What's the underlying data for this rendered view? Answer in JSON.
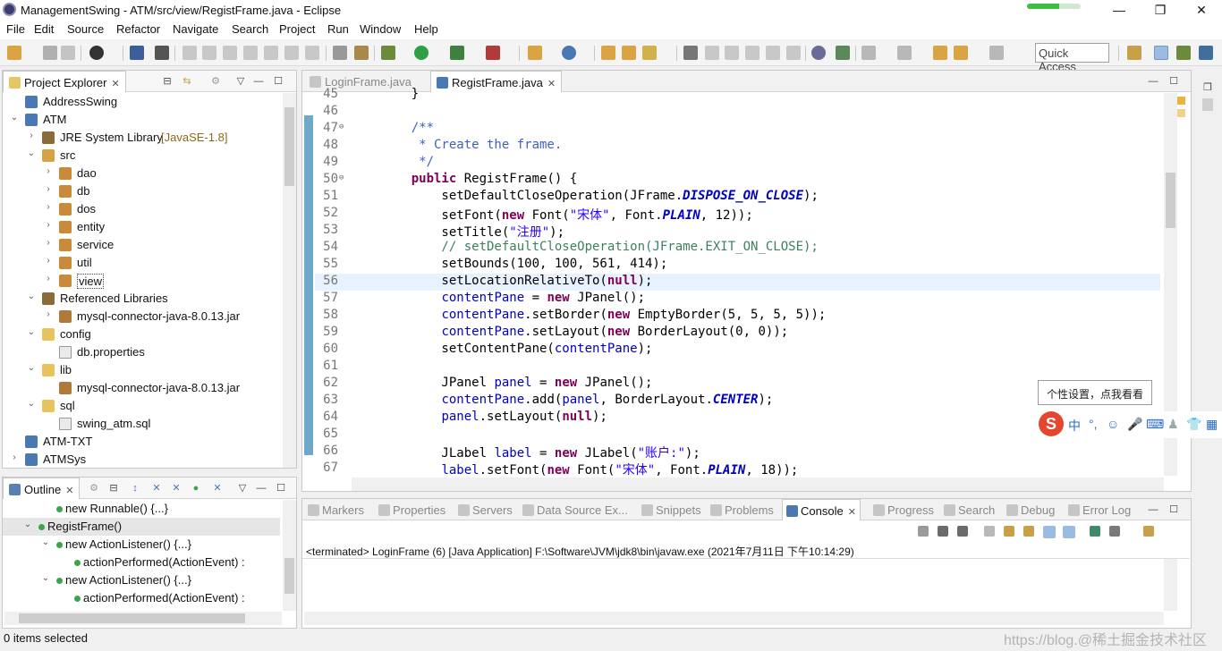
{
  "window": {
    "title": "ManagementSwing - ATM/src/view/RegistFrame.java - Eclipse",
    "controls": {
      "minimize": "—",
      "restore": "❐",
      "close": "✕"
    },
    "progress_fraction": 0.6
  },
  "menu": [
    "File",
    "Edit",
    "Source",
    "Refactor",
    "Navigate",
    "Search",
    "Project",
    "Run",
    "Window",
    "Help"
  ],
  "toolbar": {
    "quick_access": "Quick Access"
  },
  "project_explorer": {
    "tab_label": "Project Explorer",
    "close": "✕",
    "tree": [
      {
        "label": "AddressSwing",
        "icon": "project-icon",
        "arrow": ""
      },
      {
        "label": "ATM",
        "icon": "project-icon",
        "arrow": "⌄"
      },
      {
        "label": "JRE System Library",
        "label2": "[JavaSE-1.8]",
        "icon": "library-icon",
        "arrow": "›"
      },
      {
        "label": "src",
        "icon": "source-folder-icon",
        "arrow": "⌄"
      },
      {
        "label": "dao",
        "icon": "package-icon",
        "arrow": "›"
      },
      {
        "label": "db",
        "icon": "package-icon",
        "arrow": "›"
      },
      {
        "label": "dos",
        "icon": "package-icon",
        "arrow": "›"
      },
      {
        "label": "entity",
        "icon": "package-icon",
        "arrow": "›"
      },
      {
        "label": "service",
        "icon": "package-icon",
        "arrow": "›"
      },
      {
        "label": "util",
        "icon": "package-icon",
        "arrow": "›"
      },
      {
        "label": "view",
        "icon": "package-icon",
        "arrow": "›"
      },
      {
        "label": "Referenced Libraries",
        "icon": "library-icon",
        "arrow": "⌄"
      },
      {
        "label": "mysql-connector-java-8.0.13.jar",
        "icon": "jar-icon",
        "arrow": "›"
      },
      {
        "label": "config",
        "icon": "folder-icon",
        "arrow": "⌄"
      },
      {
        "label": "db.properties",
        "icon": "file-icon",
        "arrow": ""
      },
      {
        "label": "lib",
        "icon": "folder-icon",
        "arrow": "⌄"
      },
      {
        "label": "mysql-connector-java-8.0.13.jar",
        "icon": "jar-icon",
        "arrow": ""
      },
      {
        "label": "sql",
        "icon": "folder-icon",
        "arrow": "⌄"
      },
      {
        "label": "swing_atm.sql",
        "icon": "file-icon",
        "arrow": ""
      },
      {
        "label": "ATM-TXT",
        "icon": "project-icon",
        "arrow": ""
      },
      {
        "label": "ATMSys",
        "icon": "project-icon",
        "arrow": "›"
      }
    ]
  },
  "editor": {
    "tabs": [
      {
        "label": "LoginFrame.java",
        "active": false
      },
      {
        "label": "RegistFrame.java",
        "active": true,
        "close": "✕"
      }
    ],
    "lines": [
      {
        "n": "45",
        "code": "    }"
      },
      {
        "n": "46",
        "code": ""
      },
      {
        "n": "47",
        "code": "    /**",
        "fold": "⊖"
      },
      {
        "n": "48",
        "code": "     * Create the frame."
      },
      {
        "n": "49",
        "code": "     */"
      },
      {
        "n": "50",
        "code": "    public RegistFrame() {",
        "fold": "⊖"
      },
      {
        "n": "51",
        "code": "        setDefaultCloseOperation(JFrame.DISPOSE_ON_CLOSE);"
      },
      {
        "n": "52",
        "code": "        setFont(new Font(\"宋体\", Font.PLAIN, 12));"
      },
      {
        "n": "53",
        "code": "        setTitle(\"注册\");"
      },
      {
        "n": "54",
        "code": "        // setDefaultCloseOperation(JFrame.EXIT_ON_CLOSE);"
      },
      {
        "n": "55",
        "code": "        setBounds(100, 100, 561, 414);"
      },
      {
        "n": "56",
        "code": "        setLocationRelativeTo(null);"
      },
      {
        "n": "57",
        "code": "        contentPane = new JPanel();"
      },
      {
        "n": "58",
        "code": "        contentPane.setBorder(new EmptyBorder(5, 5, 5, 5));"
      },
      {
        "n": "59",
        "code": "        contentPane.setLayout(new BorderLayout(0, 0));"
      },
      {
        "n": "60",
        "code": "        setContentPane(contentPane);"
      },
      {
        "n": "61",
        "code": ""
      },
      {
        "n": "62",
        "code": "        JPanel panel = new JPanel();"
      },
      {
        "n": "63",
        "code": "        contentPane.add(panel, BorderLayout.CENTER);"
      },
      {
        "n": "64",
        "code": "        panel.setLayout(null);"
      },
      {
        "n": "65",
        "code": ""
      },
      {
        "n": "66",
        "code": "        JLabel label = new JLabel(\"账户:\");"
      },
      {
        "n": "67",
        "code": "        label.setFont(new Font(\"宋体\", Font.PLAIN, 18));"
      }
    ]
  },
  "outline": {
    "tab_label": "Outline",
    "close": "✕",
    "rows": [
      {
        "label": "new Runnable() {...}",
        "arrow": ""
      },
      {
        "label": "RegistFrame()",
        "arrow": "⌄"
      },
      {
        "label": "new ActionListener() {...}",
        "arrow": "⌄"
      },
      {
        "label": "actionPerformed(ActionEvent) :",
        "arrow": ""
      },
      {
        "label": "new ActionListener() {...}",
        "arrow": "⌄"
      },
      {
        "label": "actionPerformed(ActionEvent) :",
        "arrow": ""
      }
    ]
  },
  "console_panel": {
    "tabs": [
      "Markers",
      "Properties",
      "Servers",
      "Data Source Ex...",
      "Snippets",
      "Problems",
      "Console",
      "Progress",
      "Search",
      "Debug",
      "Error Log"
    ],
    "active_tab": "Console",
    "close": "✕",
    "terminated_line": "<terminated> LoginFrame (6) [Java Application] F:\\Software\\JVM\\jdk8\\bin\\javaw.exe (2021年7月11日 下午10:14:29)"
  },
  "status": {
    "text": "0 items selected"
  },
  "ime": {
    "tooltip": "个性设置，点我看看",
    "logo": "S",
    "mode": "中",
    "punct": "°,"
  },
  "watermark": "https://blog.@稀土掘金技术社区"
}
